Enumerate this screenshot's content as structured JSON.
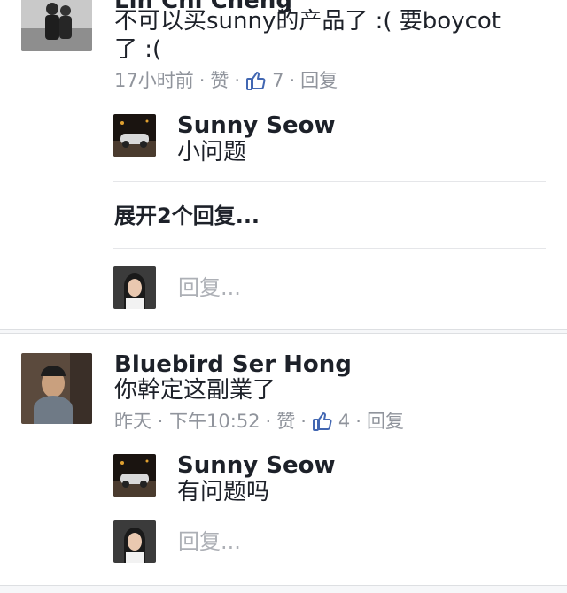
{
  "comment1": {
    "author": "Lin Chi Cheng",
    "text_line1": "不可以买sunny的产品了 :( 要boycot",
    "text_line2": "了 :(",
    "time": "17小时前",
    "like_label": "赞",
    "like_count": "7",
    "reply_label": "回复",
    "reply": {
      "author": "Sunny Seow",
      "text": "小问题"
    },
    "expand_label": "展开2个回复...",
    "reply_placeholder": "回复..."
  },
  "comment2": {
    "author": "Bluebird Ser Hong",
    "text": "你幹定这副業了",
    "time": "昨天 · 下午10:52",
    "like_label": "赞",
    "like_count": "4",
    "reply_label": "回复",
    "reply": {
      "author": "Sunny Seow",
      "text": "有问题吗"
    },
    "reply_placeholder": "回复..."
  },
  "colors": {
    "text": "#1d2129",
    "meta": "#90949c",
    "like_blue": "#4267b2",
    "divider": "#e5e6e9"
  },
  "icons": {
    "like": "thumbs-up-icon"
  }
}
